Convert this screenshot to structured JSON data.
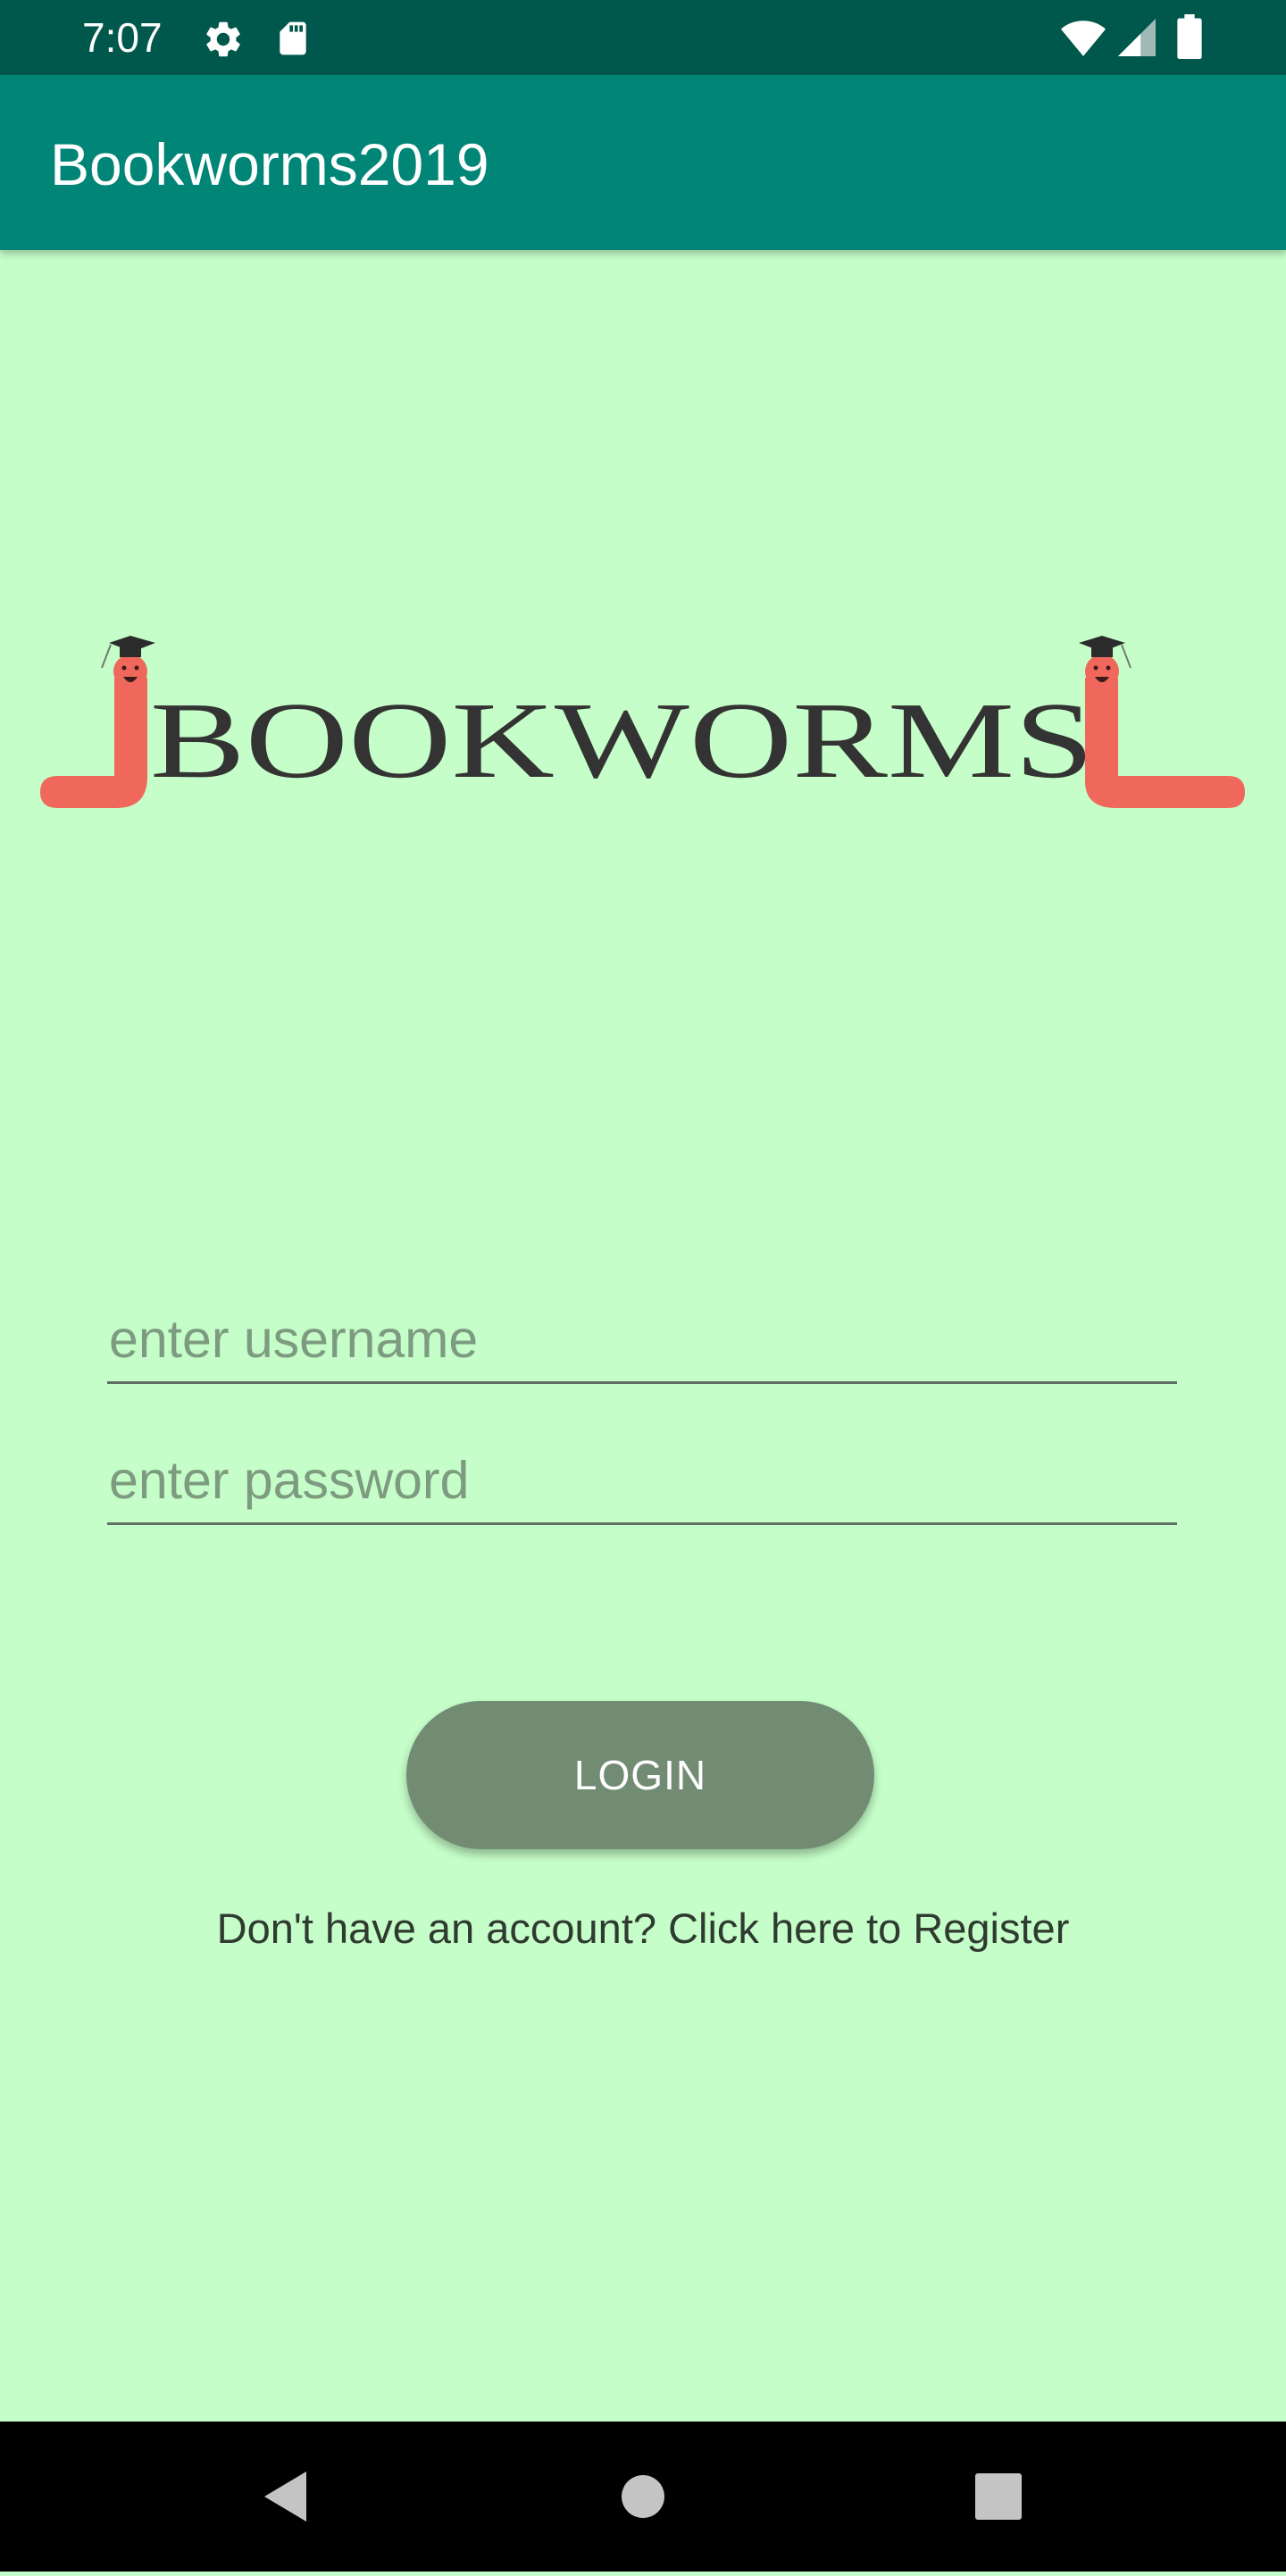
{
  "status_bar": {
    "time": "7:07",
    "icons": [
      "gear-icon",
      "sd-card-icon",
      "wifi-icon",
      "cell-signal-icon",
      "battery-icon"
    ]
  },
  "app_bar": {
    "title": "Bookworms2019"
  },
  "logo": {
    "text": "BOOKWORMS",
    "worm_color": "#f0675c",
    "cap_color": "#2b2b2b"
  },
  "login_form": {
    "username": {
      "placeholder": "enter username",
      "value": ""
    },
    "password": {
      "placeholder": "enter password",
      "value": ""
    },
    "login_label": "LOGIN",
    "register_text": "Don't have an account? Click here to Register"
  },
  "nav_bar": {
    "buttons": [
      "back-icon",
      "home-icon",
      "recents-icon"
    ]
  },
  "colors": {
    "status_bar": "#00574b",
    "app_bar": "#008577",
    "background": "#c5fec8",
    "button": "#728c74"
  }
}
